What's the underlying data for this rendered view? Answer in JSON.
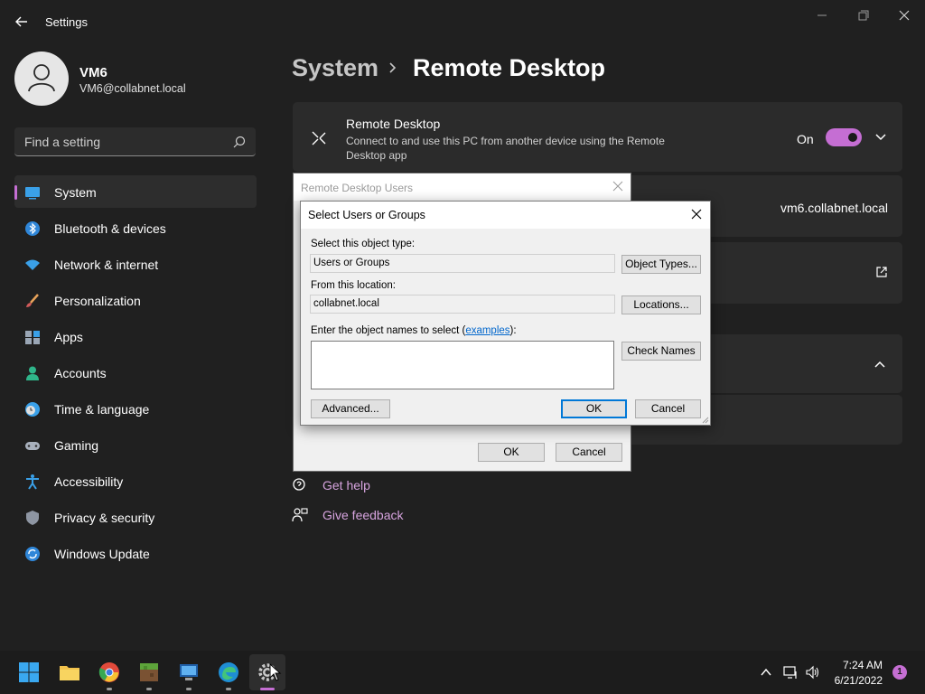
{
  "window": {
    "title": "Settings"
  },
  "profile": {
    "name": "VM6",
    "email": "VM6@collabnet.local"
  },
  "search": {
    "placeholder": "Find a setting"
  },
  "nav": {
    "items": [
      {
        "label": "System",
        "active": true
      },
      {
        "label": "Bluetooth & devices"
      },
      {
        "label": "Network & internet"
      },
      {
        "label": "Personalization"
      },
      {
        "label": "Apps"
      },
      {
        "label": "Accounts"
      },
      {
        "label": "Time & language"
      },
      {
        "label": "Gaming"
      },
      {
        "label": "Accessibility"
      },
      {
        "label": "Privacy & security"
      },
      {
        "label": "Windows Update"
      }
    ]
  },
  "header": {
    "section": "System",
    "page": "Remote Desktop"
  },
  "remote_desktop": {
    "title": "Remote Desktop",
    "description": "Connect to and use this PC from another device using the Remote Desktop app",
    "toggle_label": "On",
    "toggle_on": true
  },
  "pc_name": {
    "value": "vm6.collabnet.local"
  },
  "help": {
    "get_help": "Get help",
    "give_feedback": "Give feedback"
  },
  "rdu_dialog": {
    "title": "Remote Desktop Users",
    "ok": "OK",
    "cancel": "Cancel"
  },
  "select_dialog": {
    "title": "Select Users or Groups",
    "object_type_label": "Select this object type:",
    "object_type_value": "Users or Groups",
    "object_types_button": "Object Types...",
    "location_label": "From this location:",
    "location_value": "collabnet.local",
    "locations_button": "Locations...",
    "names_label": "Enter the object names to select (",
    "names_link": "examples",
    "names_label_end": "):",
    "names_value": "",
    "check_names_button": "Check Names",
    "advanced_button": "Advanced...",
    "ok": "OK",
    "cancel": "Cancel"
  },
  "taskbar": {
    "time": "7:24 AM",
    "date": "6/21/2022",
    "notification_count": "1"
  },
  "colors": {
    "accent": "#c56ed3",
    "background": "#202020",
    "card": "#2b2b2b"
  }
}
